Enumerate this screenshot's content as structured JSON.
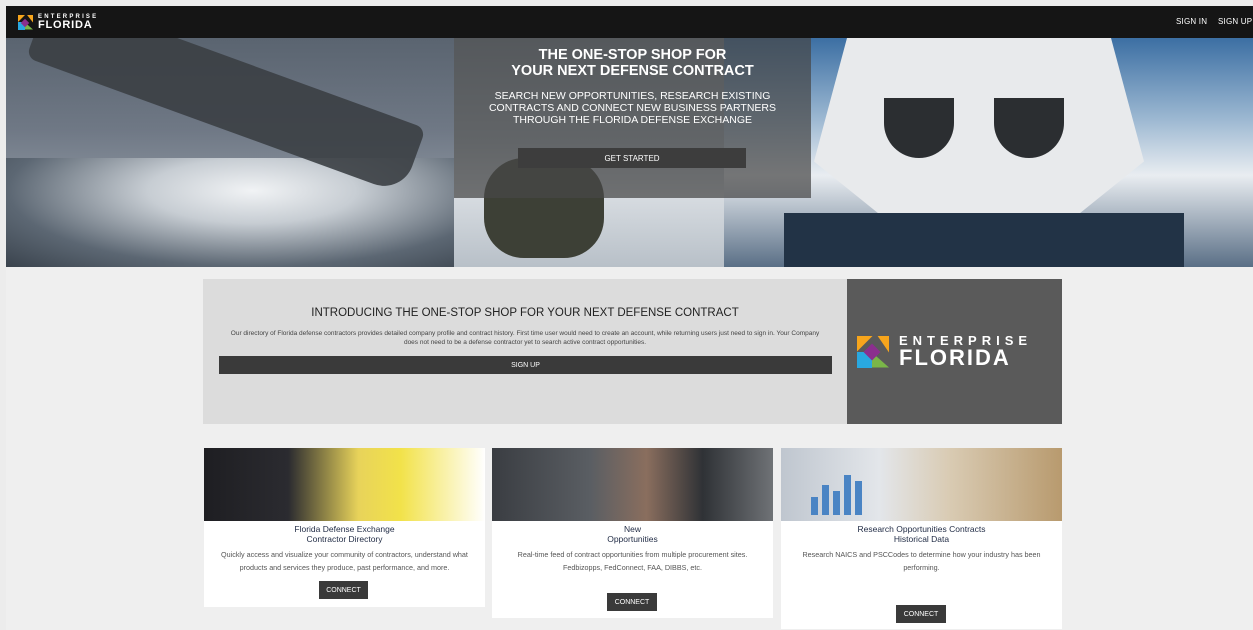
{
  "nav": {
    "logo_line1": "ENTERPRISE",
    "logo_line2": "FLORIDA",
    "sign_in": "SIGN IN",
    "sign_up": "SIGN UP"
  },
  "hero": {
    "title_line1": "THE ONE-STOP SHOP FOR",
    "title_line2": "YOUR NEXT DEFENSE CONTRACT",
    "subtitle": "SEARCH NEW OPPORTUNITIES, RESEARCH EXISTING CONTRACTS AND CONNECT NEW BUSINESS PARTNERS THROUGH THE FLORIDA DEFENSE EXCHANGE",
    "cta": "GET STARTED"
  },
  "intro": {
    "title": "INTRODUCING THE ONE-STOP SHOP FOR YOUR NEXT DEFENSE CONTRACT",
    "text": "Our directory of Florida defense contractors provides detailed company profile and contract history. First time user would need to create an account, while returning users just need to sign in. Your Company does not need to be a defense contractor yet to search active contract opportunities.",
    "button": "SIGN UP",
    "logo_line1": "ENTERPRISE",
    "logo_line2": "FLORIDA"
  },
  "cards": [
    {
      "title_line1": "Florida Defense Exchange",
      "title_line2": "Contractor Directory",
      "desc": "Quickly access and visualize your community of contractors, understand what products and services they produce, past performance, and more.",
      "button": "CONNECT"
    },
    {
      "title_line1": "New",
      "title_line2": "Opportunities",
      "desc": "Real-time feed of contract opportunities from multiple procurement sites. Fedbizopps, FedConnect, FAA, DIBBS, etc.",
      "button": "CONNECT"
    },
    {
      "title_line1": "Research Opportunities Contracts",
      "title_line2": "Historical Data",
      "desc": "Research NAICS and PSCCodes to determine how your industry has been performing.",
      "button": "CONNECT"
    }
  ],
  "colors": {
    "nav_bg": "#151515",
    "logo_orange": "#f7a51c",
    "logo_blue": "#29a8e0",
    "logo_green": "#7ab648",
    "logo_purple": "#8b2f8e",
    "button_dark": "#3a3a3a"
  }
}
